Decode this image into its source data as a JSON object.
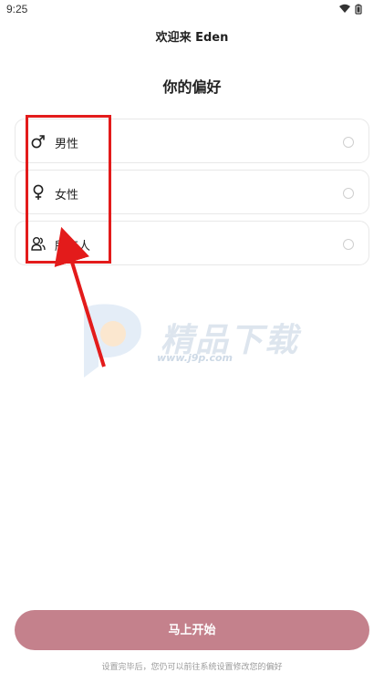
{
  "status_bar": {
    "time": "9:25",
    "icons": [
      "wifi-icon",
      "battery-icon"
    ]
  },
  "header": {
    "app_title": "欢迎来 Eden"
  },
  "page": {
    "title": "你的偏好"
  },
  "options": [
    {
      "label": "男性",
      "icon": "male-symbol-icon",
      "selected": false
    },
    {
      "label": "女性",
      "icon": "female-symbol-icon",
      "selected": false
    },
    {
      "label": "所有人",
      "icon": "people-icon",
      "selected": false
    }
  ],
  "watermark": {
    "text": "精品下载",
    "url": "www.j9p.com"
  },
  "footer": {
    "start_button_label": "马上开始",
    "note": "设置完毕后，您仍可以前往系统设置修改您的偏好"
  },
  "colors": {
    "button": "#c4818c",
    "annotation": "#e31b1b",
    "border": "#e8e8e8"
  }
}
